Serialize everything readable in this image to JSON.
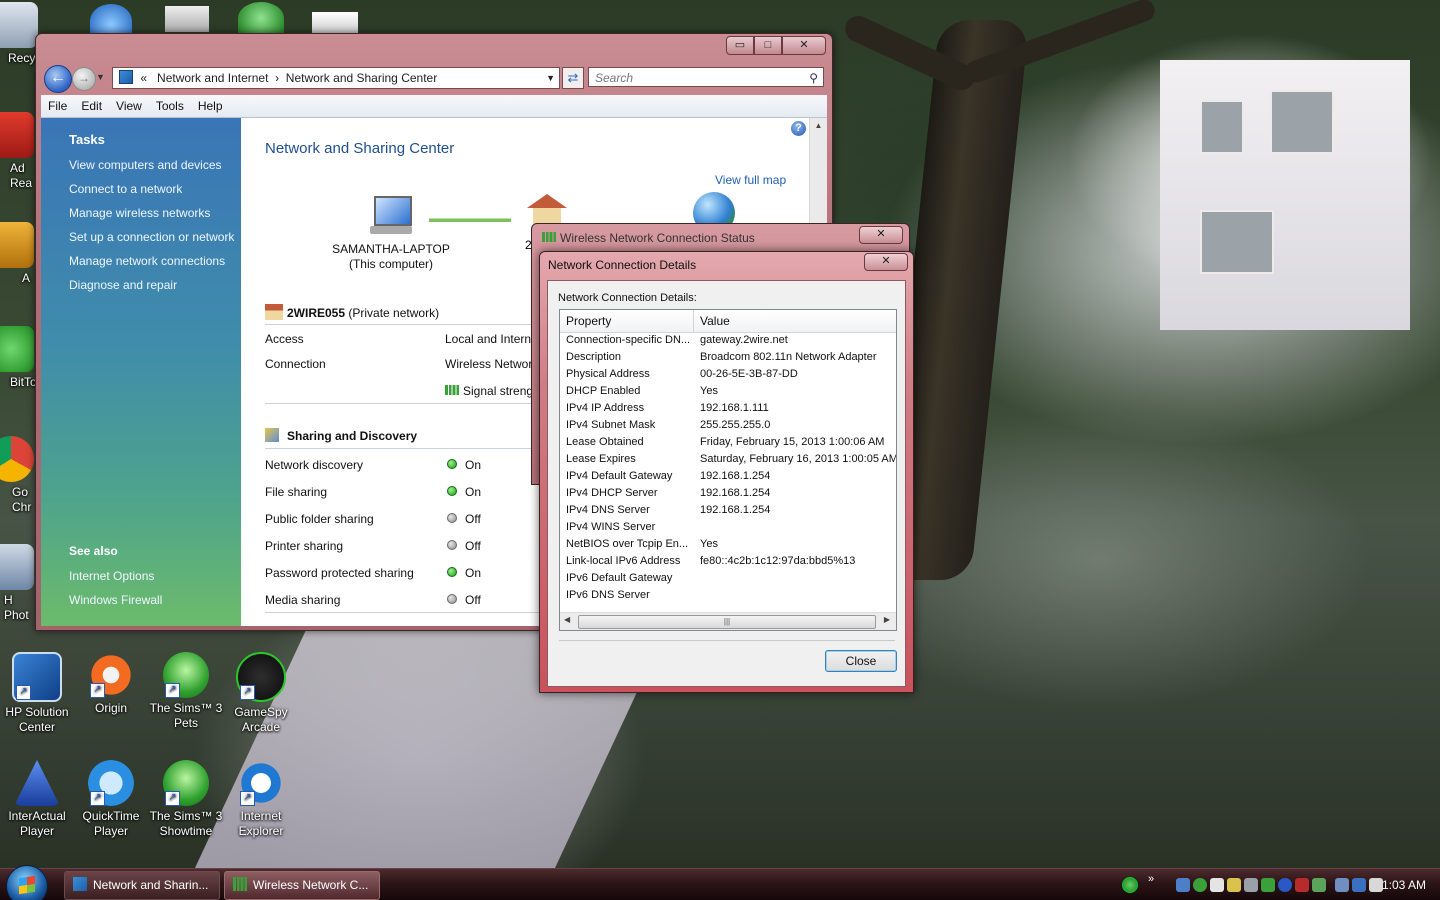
{
  "desktop": {
    "top_icons": [
      "Recy",
      "Ad Rea",
      "A",
      "BitTo",
      "Go Chr",
      "H Phot"
    ],
    "icons": [
      {
        "label": "HP Solution Center"
      },
      {
        "label": "Origin"
      },
      {
        "label": "The Sims™ 3 Pets"
      },
      {
        "label": "GameSpy Arcade"
      },
      {
        "label": "InterActual Player"
      },
      {
        "label": "QuickTime Player"
      },
      {
        "label": "The Sims™ 3 Showtime"
      },
      {
        "label": "Internet Explorer"
      }
    ]
  },
  "explorer": {
    "caption": {
      "min": "▭",
      "max": "□",
      "close": "✕"
    },
    "address": {
      "prefix": "«",
      "crumb1": "Network and Internet",
      "sep": "›",
      "crumb2": "Network and Sharing Center"
    },
    "search_placeholder": "Search",
    "menu": [
      "File",
      "Edit",
      "View",
      "Tools",
      "Help"
    ],
    "sidebar": {
      "tasks_heading": "Tasks",
      "tasks": [
        "View computers and devices",
        "Connect to a network",
        "Manage wireless networks",
        "Set up a connection or network",
        "Manage network connections",
        "Diagnose and repair"
      ],
      "see_also_heading": "See also",
      "see_also": [
        "Internet Options",
        "Windows Firewall"
      ]
    },
    "content": {
      "title": "Network and Sharing Center",
      "view_full_map": "View full map",
      "computer_name": "SAMANTHA-LAPTOP",
      "computer_sub": "(This computer)",
      "house_label": "2",
      "network_name": "2WIRE055",
      "network_type": "(Private network)",
      "access_label": "Access",
      "access_value": "Local and Interne",
      "connection_label": "Connection",
      "connection_value": "Wireless Networ",
      "signal_label": "Signal streng",
      "sharing_heading": "Sharing and Discovery",
      "sharing": [
        {
          "label": "Network discovery",
          "state": "On",
          "on": true
        },
        {
          "label": "File sharing",
          "state": "On",
          "on": true
        },
        {
          "label": "Public folder sharing",
          "state": "Off",
          "on": false
        },
        {
          "label": "Printer sharing",
          "state": "Off",
          "on": false
        },
        {
          "label": "Password protected sharing",
          "state": "On",
          "on": true
        },
        {
          "label": "Media sharing",
          "state": "Off",
          "on": false
        }
      ]
    }
  },
  "status_window": {
    "title": "Wireless Network Connection Status",
    "close": "✕"
  },
  "details_dialog": {
    "title": "Network Connection Details",
    "close_glyph": "✕",
    "label": "Network Connection Details:",
    "col_property": "Property",
    "col_value": "Value",
    "rows": [
      {
        "p": "Connection-specific DN...",
        "v": "gateway.2wire.net"
      },
      {
        "p": "Description",
        "v": "Broadcom 802.11n Network Adapter"
      },
      {
        "p": "Physical Address",
        "v": "00-26-5E-3B-87-DD"
      },
      {
        "p": "DHCP Enabled",
        "v": "Yes"
      },
      {
        "p": "IPv4 IP Address",
        "v": "192.168.1.111"
      },
      {
        "p": "IPv4 Subnet Mask",
        "v": "255.255.255.0"
      },
      {
        "p": "Lease Obtained",
        "v": "Friday, February 15, 2013 1:00:06 AM"
      },
      {
        "p": "Lease Expires",
        "v": "Saturday, February 16, 2013 1:00:05 AM"
      },
      {
        "p": "IPv4 Default Gateway",
        "v": "192.168.1.254"
      },
      {
        "p": "IPv4 DHCP Server",
        "v": "192.168.1.254"
      },
      {
        "p": "IPv4 DNS Server",
        "v": "192.168.1.254"
      },
      {
        "p": "IPv4 WINS Server",
        "v": ""
      },
      {
        "p": "NetBIOS over Tcpip En...",
        "v": "Yes"
      },
      {
        "p": "Link-local IPv6 Address",
        "v": "fe80::4c2b:1c12:97da:bbd5%13"
      },
      {
        "p": "IPv6 Default Gateway",
        "v": ""
      },
      {
        "p": "IPv6 DNS Server",
        "v": ""
      }
    ],
    "close_button": "Close"
  },
  "taskbar": {
    "buttons": [
      {
        "label": "Network and Sharin..."
      },
      {
        "label": "Wireless Network C..."
      }
    ],
    "chevron": "»",
    "clock": "1:03 AM"
  }
}
